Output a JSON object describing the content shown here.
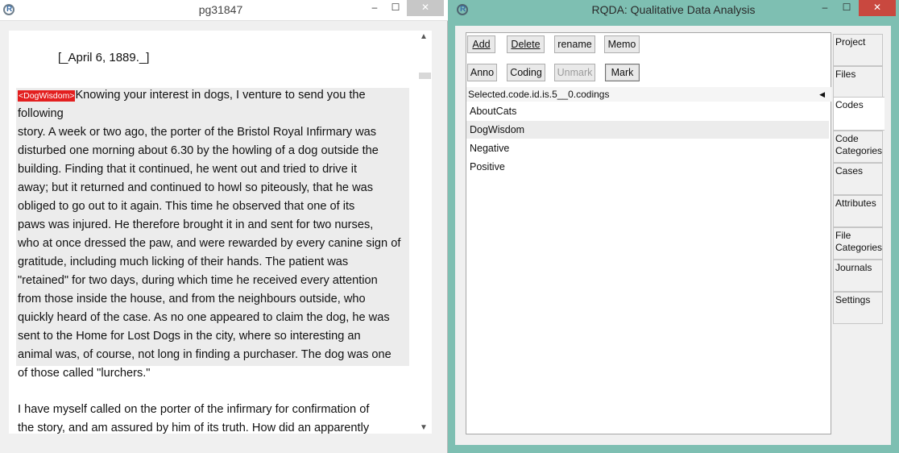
{
  "left_window": {
    "title": "pg31847",
    "controls": {
      "minimize": "–",
      "maximize": "☐",
      "close": "✕"
    },
    "document": {
      "date_line": "[_April 6, 1889._]",
      "code_tag": "<DogWisdom>",
      "lines": [
        "Knowing your interest in dogs, I venture to send you the",
        "following",
        "story. A week or two ago, the porter of the Bristol Royal Infirmary was",
        "disturbed one morning about 6.30 by the howling of a dog outside the",
        "building. Finding that it continued, he went out and tried to drive it",
        "away; but it returned and continued to howl so piteously, that he was",
        "obliged to go out to it again. This time he observed that one of its",
        "paws was injured. He therefore brought it in and sent for two nurses,",
        "who at once dressed the paw, and were rewarded by every canine sign of",
        "gratitude, including much licking of their hands. The patient was",
        "\"retained\" for two days, during which time he received every attention",
        "from those inside the house, and from the neighbours outside, who",
        "quickly heard of the case. As no one appeared to claim the dog, he was",
        "sent to the Home for Lost Dogs in the city, where so interesting an",
        "animal was, of course, not long in finding a purchaser. The dog was one",
        "of those called \"lurchers.\""
      ],
      "tail_lines": [
        "I have myself called on the porter of the infirmary for confirmation of",
        "the story, and am assured by him of its truth. How did an apparently"
      ]
    }
  },
  "right_window": {
    "title": "RQDA: Qualitative Data Analysis",
    "controls": {
      "minimize": "–",
      "maximize": "☐",
      "close": "✕"
    },
    "toolbar_row1": {
      "add": "Add",
      "delete": "Delete",
      "rename": "rename",
      "memo": "Memo"
    },
    "toolbar_row2": {
      "anno": "Anno",
      "coding": "Coding",
      "unmark": "Unmark",
      "mark": "Mark"
    },
    "codings_header": "Selected.code.id.is.5__0.codings",
    "codes": [
      "AboutCats",
      "DogWisdom",
      "Negative",
      "Positive"
    ],
    "selected_code": "DogWisdom",
    "tabs": [
      "Project",
      "Files",
      "Codes",
      "Code Categories",
      "Cases",
      "Attributes",
      "File Categories",
      "Journals",
      "Settings"
    ],
    "active_tab": "Codes"
  },
  "colors": {
    "accent_teal": "#7ebfb2",
    "code_tag_red": "#e31f1f",
    "close_red": "#c9483f"
  }
}
